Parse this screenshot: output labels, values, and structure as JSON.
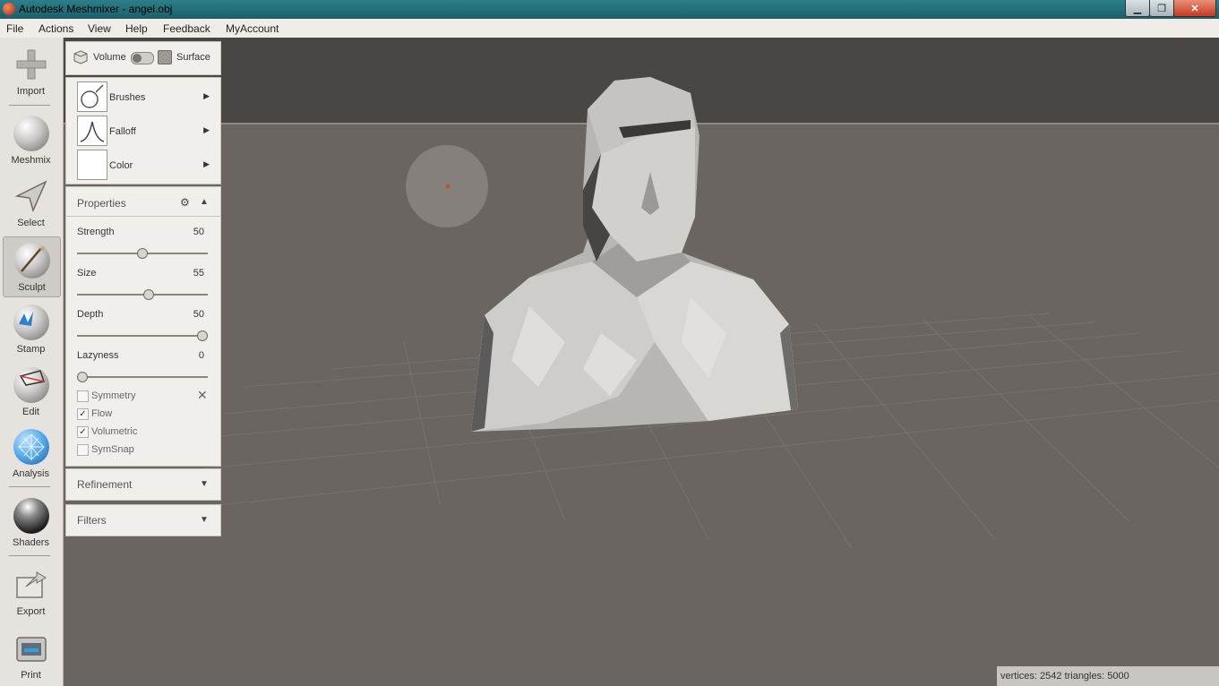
{
  "window": {
    "title": "Autodesk Meshmixer - angel.obj",
    "minimize_glyph": "▁",
    "maximize_glyph": "❐",
    "close_glyph": "✕"
  },
  "menu": [
    "File",
    "Actions",
    "View",
    "Help",
    "Feedback",
    "MyAccount"
  ],
  "tools": [
    {
      "label": "Import",
      "icon": "plus-icon"
    },
    {
      "label": "Meshmix",
      "icon": "sphere-face-icon"
    },
    {
      "label": "Select",
      "icon": "arrow-cursor-icon"
    },
    {
      "label": "Sculpt",
      "icon": "brush-sphere-icon",
      "active": true
    },
    {
      "label": "Stamp",
      "icon": "stamp-icon"
    },
    {
      "label": "Edit",
      "icon": "edit-sphere-icon"
    },
    {
      "label": "Analysis",
      "icon": "analysis-sphere-icon"
    },
    {
      "label": "Shaders",
      "icon": "shader-sphere-icon"
    },
    {
      "label": "Export",
      "icon": "export-icon"
    },
    {
      "label": "Print",
      "icon": "printer-icon"
    }
  ],
  "mode": {
    "volume": "Volume",
    "surface": "Surface"
  },
  "brush_panel": {
    "brushes": "Brushes",
    "falloff": "Falloff",
    "color": "Color",
    "arrow": "▶"
  },
  "properties": {
    "title": "Properties",
    "gear": "⚙",
    "collapse": "▲",
    "sliders": [
      {
        "label": "Strength",
        "value": "50",
        "fraction": 0.5
      },
      {
        "label": "Size",
        "value": "55",
        "fraction": 0.55
      },
      {
        "label": "Depth",
        "value": "50",
        "fraction": 1.0
      },
      {
        "label": "Lazyness",
        "value": "0",
        "fraction": 0.0
      }
    ],
    "checks": [
      {
        "label": "Symmetry",
        "checked": false
      },
      {
        "label": "Flow",
        "checked": true
      },
      {
        "label": "Volumetric",
        "checked": true
      },
      {
        "label": "SymSnap",
        "checked": false
      }
    ],
    "check_glyph": "✓",
    "symmetry_icon": "✕"
  },
  "refinement": {
    "title": "Refinement",
    "arrow": "▼"
  },
  "filters": {
    "title": "Filters",
    "arrow": "▼"
  },
  "status": "vertices: 2542 triangles: 5000"
}
